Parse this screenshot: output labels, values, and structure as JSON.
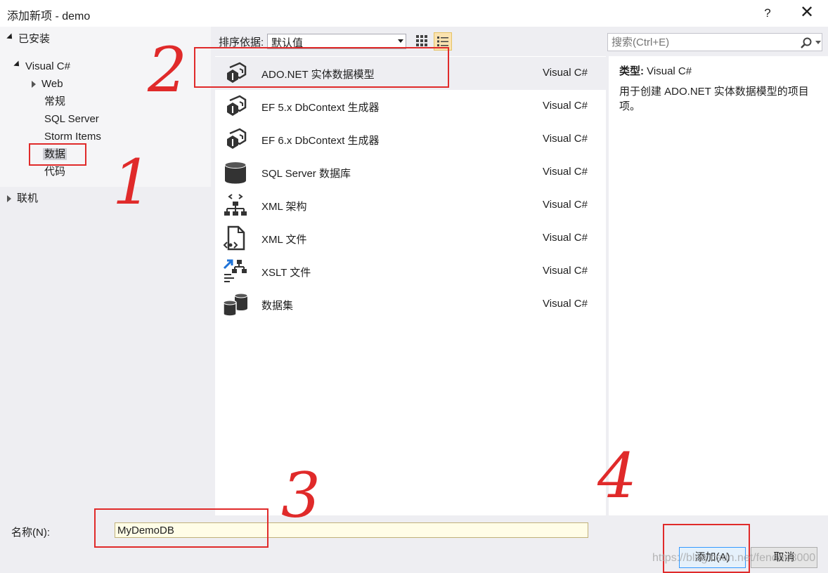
{
  "window": {
    "title": "添加新项 - demo",
    "help": "?",
    "close": "✕"
  },
  "tree": {
    "installed": "已安装",
    "visual_csharp": "Visual C#",
    "children": [
      "Web",
      "常规",
      "SQL Server",
      "Storm Items",
      "数据",
      "代码"
    ],
    "online": "联机"
  },
  "toolbar": {
    "sort_label": "排序依据:",
    "sort_value": "默认值"
  },
  "search": {
    "placeholder": "搜索(Ctrl+E)"
  },
  "items": [
    {
      "name": "ADO.NET 实体数据模型",
      "lang": "Visual C#",
      "icon": "entity-model-icon",
      "selected": true
    },
    {
      "name": "EF 5.x DbContext 生成器",
      "lang": "Visual C#",
      "icon": "dbcontext-generator-icon"
    },
    {
      "name": "EF 6.x DbContext 生成器",
      "lang": "Visual C#",
      "icon": "dbcontext-generator-icon"
    },
    {
      "name": "SQL Server 数据库",
      "lang": "Visual C#",
      "icon": "database-icon"
    },
    {
      "name": "XML 架构",
      "lang": "Visual C#",
      "icon": "xml-schema-icon"
    },
    {
      "name": "XML 文件",
      "lang": "Visual C#",
      "icon": "xml-file-icon"
    },
    {
      "name": "XSLT 文件",
      "lang": "Visual C#",
      "icon": "xslt-file-icon"
    },
    {
      "name": "数据集",
      "lang": "Visual C#",
      "icon": "dataset-icon"
    }
  ],
  "details": {
    "type_label": "类型:",
    "type_value": "Visual C#",
    "description": "用于创建 ADO.NET 实体数据模型的项目项。"
  },
  "bottom": {
    "name_label": "名称(N):",
    "name_value": "MyDemoDB",
    "add_label": "添加(A)",
    "cancel_label": "取消"
  },
  "annotations": [
    "1",
    "2",
    "3",
    "4"
  ],
  "watermark": "https://blog.csdn.net/fendou3000",
  "colors": {
    "annotation": "#e02a2a",
    "selection": "#eeeef2",
    "panel": "#eeeef2"
  }
}
